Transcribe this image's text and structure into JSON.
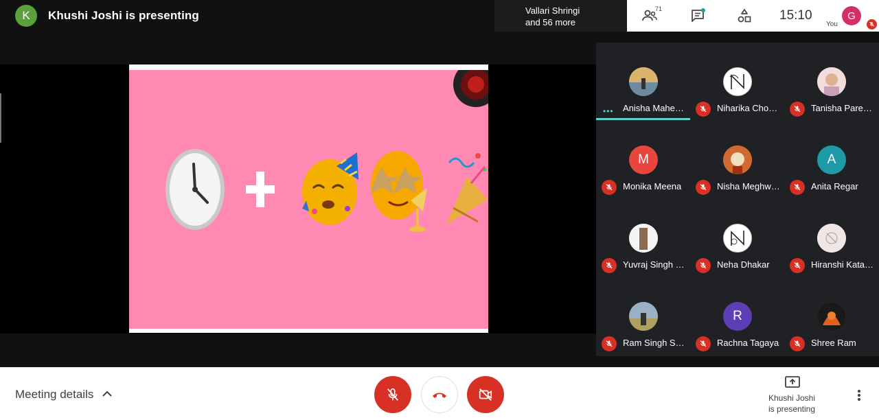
{
  "header": {
    "presenter_initial": "K",
    "presenter_title": "Khushi Joshi is presenting",
    "viewers_line1": "Vallari Shringi",
    "viewers_line2": "and 56 more",
    "people_count": "71",
    "time": "15:10",
    "you_initial": "G",
    "you_label": "You"
  },
  "participants": [
    {
      "name": "Anisha Mahe…",
      "initial": "",
      "avatar": "photo",
      "color": "#9fb7c9",
      "muted": false,
      "speaking": true
    },
    {
      "name": "Niharika Cho…",
      "initial": "",
      "avatar": "monogram-n",
      "color": "#ffffff",
      "muted": true,
      "speaking": false
    },
    {
      "name": "Tanisha Pare…",
      "initial": "",
      "avatar": "photo",
      "color": "#e8c8c8",
      "muted": true,
      "speaking": false
    },
    {
      "name": "Monika Meena",
      "initial": "M",
      "avatar": "letter",
      "color": "#e8453c",
      "muted": true,
      "speaking": false
    },
    {
      "name": "Nisha Meghw…",
      "initial": "",
      "avatar": "photo",
      "color": "#c0704a",
      "muted": true,
      "speaking": false
    },
    {
      "name": "Anita Regar",
      "initial": "A",
      "avatar": "letter",
      "color": "#1e9aa8",
      "muted": true,
      "speaking": false
    },
    {
      "name": "Yuvraj Singh …",
      "initial": "",
      "avatar": "photo",
      "color": "#d8cfc4",
      "muted": true,
      "speaking": false
    },
    {
      "name": "Neha Dhakar",
      "initial": "",
      "avatar": "monogram-n",
      "color": "#ffffff",
      "muted": true,
      "speaking": false
    },
    {
      "name": "Hiranshi Kata…",
      "initial": "",
      "avatar": "photo",
      "color": "#eadede",
      "muted": true,
      "speaking": false
    },
    {
      "name": "Ram Singh Si…",
      "initial": "",
      "avatar": "photo",
      "color": "#8aa0b0",
      "muted": true,
      "speaking": false
    },
    {
      "name": "Rachna Tagaya",
      "initial": "R",
      "avatar": "letter",
      "color": "#5c3fb5",
      "muted": true,
      "speaking": false
    },
    {
      "name": "Shree Ram",
      "initial": "",
      "avatar": "photo",
      "color": "#c4541c",
      "muted": true,
      "speaking": false
    }
  ],
  "footer": {
    "meeting_details": "Meeting details",
    "present_line1": "Khushi Joshi",
    "present_line2": "is presenting"
  },
  "colors": {
    "mute_red": "#d93025",
    "speaking_teal": "#5ad4c8",
    "slide_pink": "#ff89b3"
  },
  "icons": [
    "people-icon",
    "chat-icon",
    "activities-icon",
    "mic-off-icon",
    "hang-up-icon",
    "camera-off-icon",
    "present-icon",
    "more-vert-icon",
    "chevron-up-icon"
  ]
}
